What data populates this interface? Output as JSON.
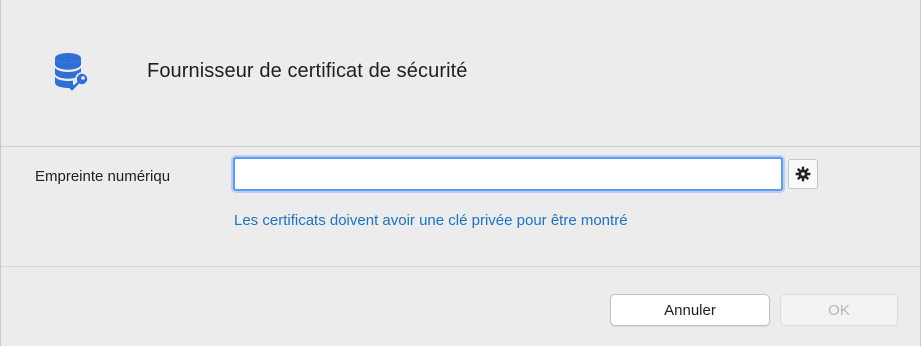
{
  "dialog": {
    "title": "Fournisseur de certificat de sécurité",
    "header_icon": "database-key-icon"
  },
  "form": {
    "field_label": "Empreinte numériqu",
    "field_value": "",
    "field_placeholder": "",
    "settings_icon": "gear-icon",
    "hint": "Les certificats doivent avoir une clé privée pour être montré"
  },
  "footer": {
    "cancel_label": "Annuler",
    "ok_label": "OK",
    "ok_enabled": false
  },
  "colors": {
    "accent": "#1a73c6",
    "icon_blue": "#2f6fd6",
    "focus_ring": "#5b9af5"
  }
}
